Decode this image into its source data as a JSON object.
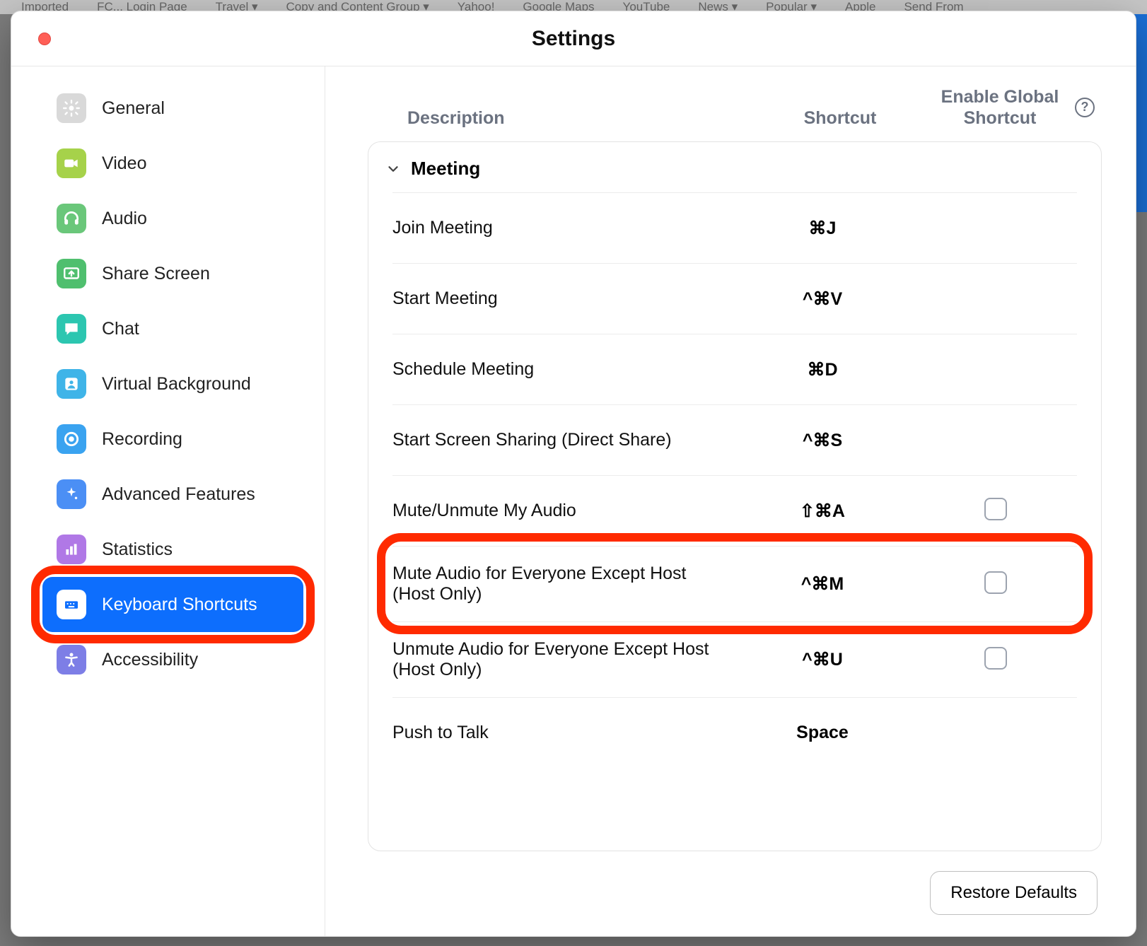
{
  "window": {
    "title": "Settings"
  },
  "bookmarks": [
    "Imported",
    "FC... Login Page",
    "Travel ▾",
    "Copy and Content Group ▾",
    "Yahoo!",
    "Google Maps",
    "YouTube",
    "News ▾",
    "Popular ▾",
    "Apple",
    "Send From"
  ],
  "sidebar": {
    "items": [
      {
        "label": "General",
        "icon": "gear-icon",
        "color": "#d9d9d9"
      },
      {
        "label": "Video",
        "icon": "video-icon",
        "color": "#a6d24a"
      },
      {
        "label": "Audio",
        "icon": "headphones-icon",
        "color": "#6ac77a"
      },
      {
        "label": "Share Screen",
        "icon": "share-screen-icon",
        "color": "#4fbf6e"
      },
      {
        "label": "Chat",
        "icon": "chat-icon",
        "color": "#2cc6b0"
      },
      {
        "label": "Virtual Background",
        "icon": "background-icon",
        "color": "#3fb4e8"
      },
      {
        "label": "Recording",
        "icon": "record-icon",
        "color": "#3aa3f0"
      },
      {
        "label": "Advanced Features",
        "icon": "sparkle-icon",
        "color": "#4b8ff5"
      },
      {
        "label": "Statistics",
        "icon": "stats-icon",
        "color": "#b078e6"
      },
      {
        "label": "Keyboard Shortcuts",
        "icon": "keyboard-icon",
        "color": "#ffffff",
        "selected": true
      },
      {
        "label": "Accessibility",
        "icon": "accessibility-icon",
        "color": "#7d7ee6"
      }
    ]
  },
  "columns": {
    "description": "Description",
    "shortcut": "Shortcut",
    "global": "Enable Global Shortcut"
  },
  "section": {
    "title": "Meeting"
  },
  "rows": [
    {
      "desc": "Join Meeting",
      "shortcut": "⌘J",
      "global": null
    },
    {
      "desc": "Start Meeting",
      "shortcut": "^⌘V",
      "global": null
    },
    {
      "desc": "Schedule Meeting",
      "shortcut": "⌘D",
      "global": null
    },
    {
      "desc": "Start Screen Sharing (Direct Share)",
      "shortcut": "^⌘S",
      "global": null
    },
    {
      "desc": "Mute/Unmute My Audio",
      "shortcut": "⇧⌘A",
      "global": false
    },
    {
      "desc": "Mute Audio for Everyone Except Host (Host Only)",
      "shortcut": "^⌘M",
      "global": false,
      "highlight": true
    },
    {
      "desc": "Unmute Audio for Everyone Except Host (Host Only)",
      "shortcut": "^⌘U",
      "global": false
    },
    {
      "desc": "Push to Talk",
      "shortcut": "Space",
      "global": null
    }
  ],
  "footer": {
    "restore": "Restore Defaults"
  }
}
